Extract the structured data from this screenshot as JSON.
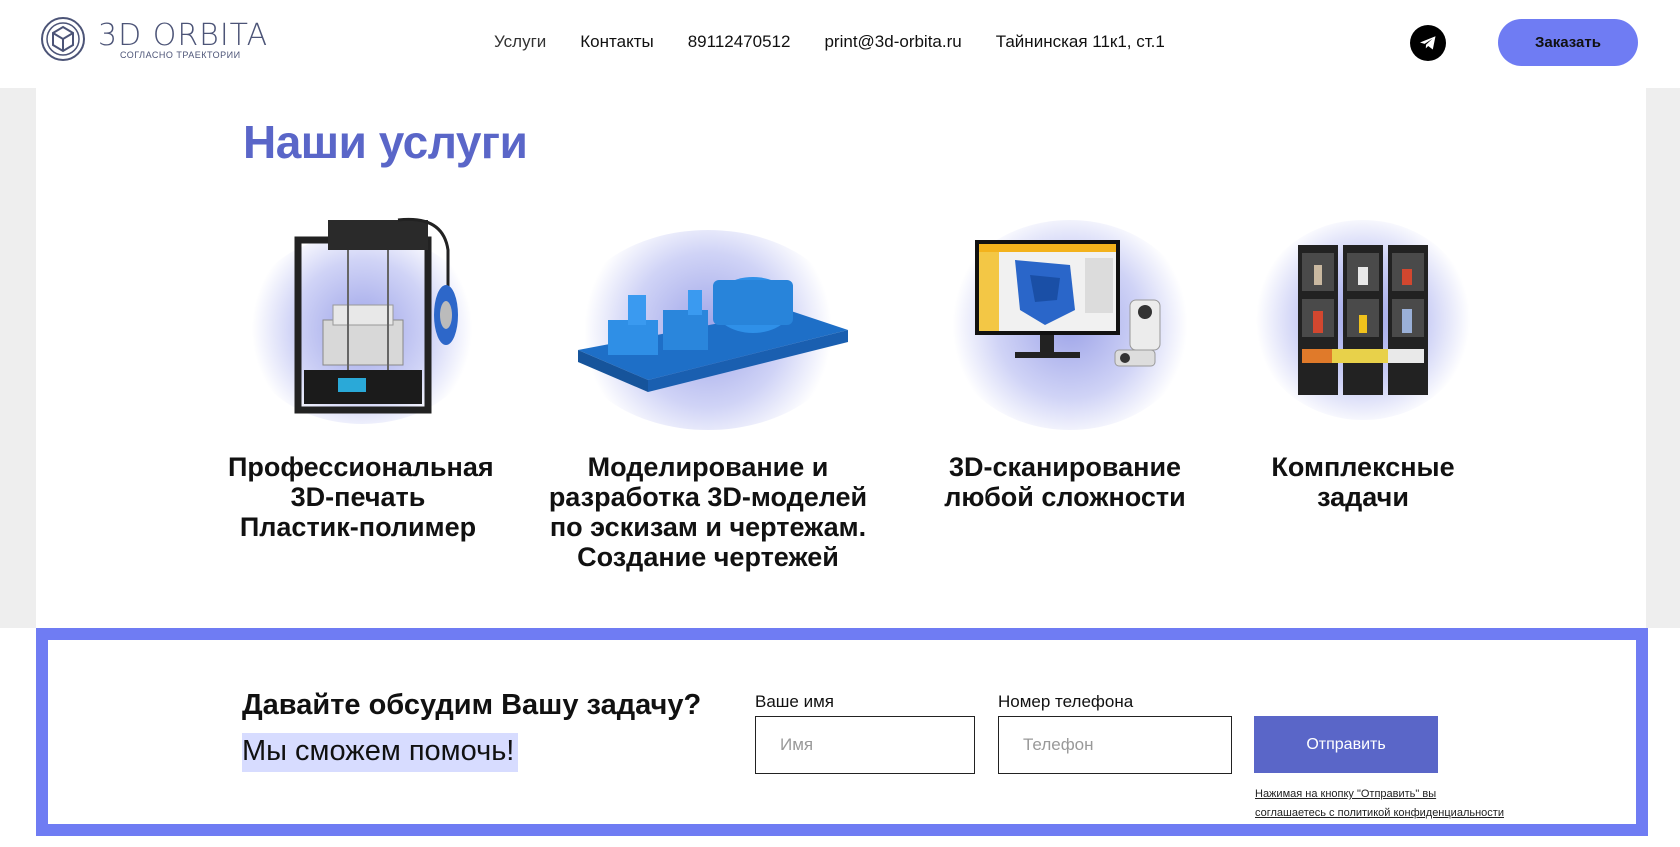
{
  "header": {
    "logo_title": "3D ORBITA",
    "logo_subtitle": "СОГЛАСНО ТРАЕКТОРИИ",
    "nav": [
      "Услуги",
      "Контакты",
      "89112470512",
      "print@3d-orbita.ru",
      "Тайнинская 11к1, ст.1"
    ],
    "order_label": "Заказать",
    "telegram_icon": "telegram-icon"
  },
  "services": {
    "title": "Наши услуги",
    "items": [
      {
        "caption": [
          "Профессиональная",
          "3D-печать",
          "Пластик-полимер"
        ],
        "image": "3d-printer-image"
      },
      {
        "caption": [
          "Моделирование и",
          "разработка 3D-моделей",
          "по эскизам и чертежам.",
          "Создание чертежей"
        ],
        "image": "3d-model-image"
      },
      {
        "caption": [
          "3D-сканирование",
          "любой сложности"
        ],
        "image": "3d-scanner-image"
      },
      {
        "caption": [
          "Комплексные",
          "задачи"
        ],
        "image": "printer-farm-image"
      }
    ]
  },
  "form": {
    "title": "Давайте обсудим Вашу задачу?",
    "subtitle": "Мы сможем помочь!",
    "name_label": "Ваше имя",
    "name_placeholder": "Имя",
    "phone_label": "Номер телефона",
    "phone_placeholder": "Телефон",
    "submit_label": "Отправить",
    "policy_line1": "Нажимая на кнопку \"Отправить\" вы",
    "policy_line2": "соглашаетесь с политикой конфиденциальности"
  },
  "colors": {
    "accent": "#6f7cf3",
    "title": "#5a66c8",
    "highlight": "#d7dcff"
  }
}
